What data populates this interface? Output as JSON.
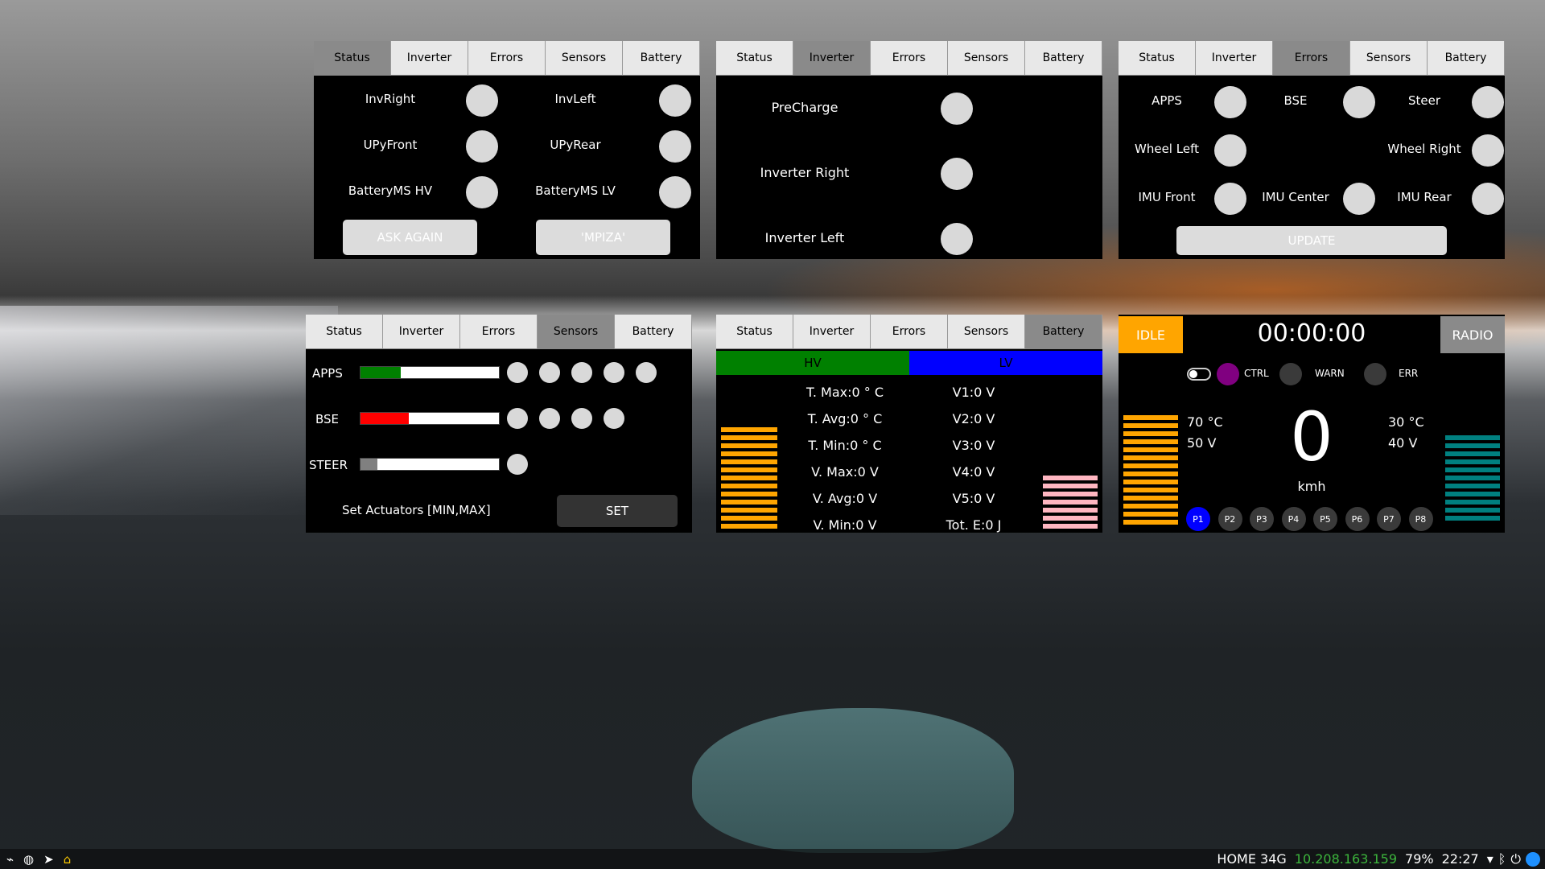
{
  "tabs": [
    "Status",
    "Inverter",
    "Errors",
    "Sensors",
    "Battery"
  ],
  "status_win": {
    "labels": [
      "InvRight",
      "InvLeft",
      "UPyFront",
      "UPyRear",
      "BatteryMS HV",
      "BatteryMS LV"
    ],
    "ask_again": "ASK AGAIN",
    "mpiza": "'MPIZA'"
  },
  "inverter_win": {
    "labels": [
      "PreCharge",
      "Inverter Right",
      "Inverter Left"
    ]
  },
  "errors_win": {
    "labels": [
      "APPS",
      "BSE",
      "Steer",
      "Wheel Left",
      "Wheel Right",
      "IMU Front",
      "IMU Center",
      "IMU Rear"
    ],
    "update": "UPDATE"
  },
  "sensors_win": {
    "labels": [
      "APPS",
      "BSE",
      "STEER"
    ],
    "bars": [
      {
        "fill": 0.29,
        "color": "#008000"
      },
      {
        "fill": 0.35,
        "color": "#ff0000"
      },
      {
        "fill": 0.12,
        "color": "#808080"
      }
    ],
    "set_label": "Set Actuators [MIN,MAX]",
    "set": "SET"
  },
  "battery_win": {
    "hv": "HV",
    "lv": "LV",
    "hv_values": [
      "T. Max:0 ° C",
      "T. Avg:0 ° C",
      "T. Min:0 ° C",
      "V. Max:0 V",
      "V. Avg:0 V",
      "V. Min:0 V"
    ],
    "lv_values": [
      "V1:0 V",
      "V2:0 V",
      "V3:0 V",
      "V4:0 V",
      "V5:0 V",
      "Tot. E:0 J"
    ],
    "colors": {
      "hv": "#008000",
      "lv": "#0000ff",
      "hv_stripes": "#ffa500",
      "lv_stripes": "#ffb6c1"
    }
  },
  "dashboard": {
    "mode": "IDLE",
    "timer": "00:00:00",
    "radio": "RADIO",
    "ctrl": "CTRL",
    "warn": "WARN",
    "err": "ERR",
    "left_temp": "70 °C",
    "left_volt": "50 V",
    "right_temp": "30 °C",
    "right_volt": "40 V",
    "speed": "0",
    "unit": "kmh",
    "presets": [
      "P1",
      "P2",
      "P3",
      "P4",
      "P5",
      "P6",
      "P7",
      "P8"
    ],
    "colors": {
      "mode": "#ffa500",
      "ctrl": "#800080",
      "p1": "#0000ff",
      "right_stripes": "#008080"
    }
  },
  "taskbar": {
    "network": "HOME 34G",
    "ip": "10.208.163.159",
    "battery": "79%",
    "time": "22:27"
  }
}
